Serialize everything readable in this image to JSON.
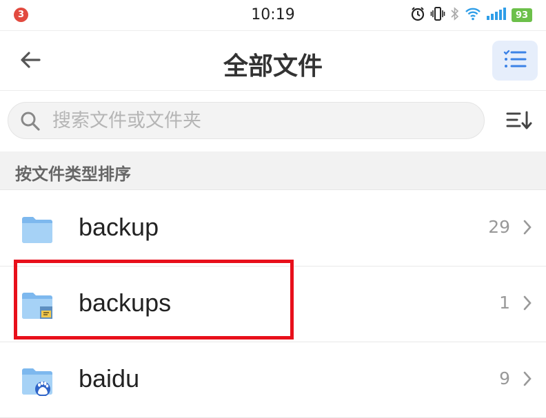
{
  "status_bar": {
    "notification_count": "3",
    "time": "10:19",
    "battery": "93",
    "icons": [
      "alarm-icon",
      "vibrate-icon",
      "bluetooth-icon",
      "wifi-icon",
      "signal-icon",
      "battery-icon"
    ]
  },
  "header": {
    "title": "全部文件",
    "back_icon": "back-arrow-icon",
    "list_mode_icon": "checklist-icon"
  },
  "search": {
    "placeholder": "搜索文件或文件夹",
    "value": "",
    "sort_icon": "sort-descending-icon"
  },
  "section": {
    "label": "按文件类型排序"
  },
  "files": [
    {
      "name": "backup",
      "count": "29",
      "icon": "folder-icon"
    },
    {
      "name": "backups",
      "count": "1",
      "icon": "folder-archive-icon"
    },
    {
      "name": "baidu",
      "count": "9",
      "icon": "folder-baidu-icon"
    }
  ],
  "colors": {
    "accent": "#3b82e6",
    "folder": "#8cc3f2",
    "highlight": "#e8101b",
    "badge": "#e24a3f",
    "battery": "#6cc04a"
  }
}
